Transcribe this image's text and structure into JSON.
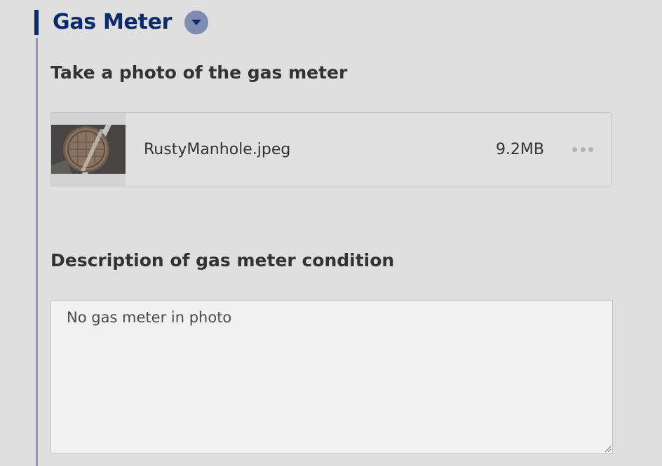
{
  "section": {
    "title": "Gas Meter",
    "toggle_icon": "caret-down-icon",
    "accent_color": "#0b2a6b",
    "toggle_color": "#7d8db4"
  },
  "photo_question": {
    "label": "Take a photo of the gas meter",
    "attachment": {
      "file_name": "RustyManhole.jpeg",
      "file_size": "9.2MB",
      "thumbnail_icon": "manhole-photo-thumbnail",
      "menu_icon": "more-horizontal-icon"
    }
  },
  "description_question": {
    "label": "Description of gas meter condition",
    "value": "No gas meter in photo"
  }
}
